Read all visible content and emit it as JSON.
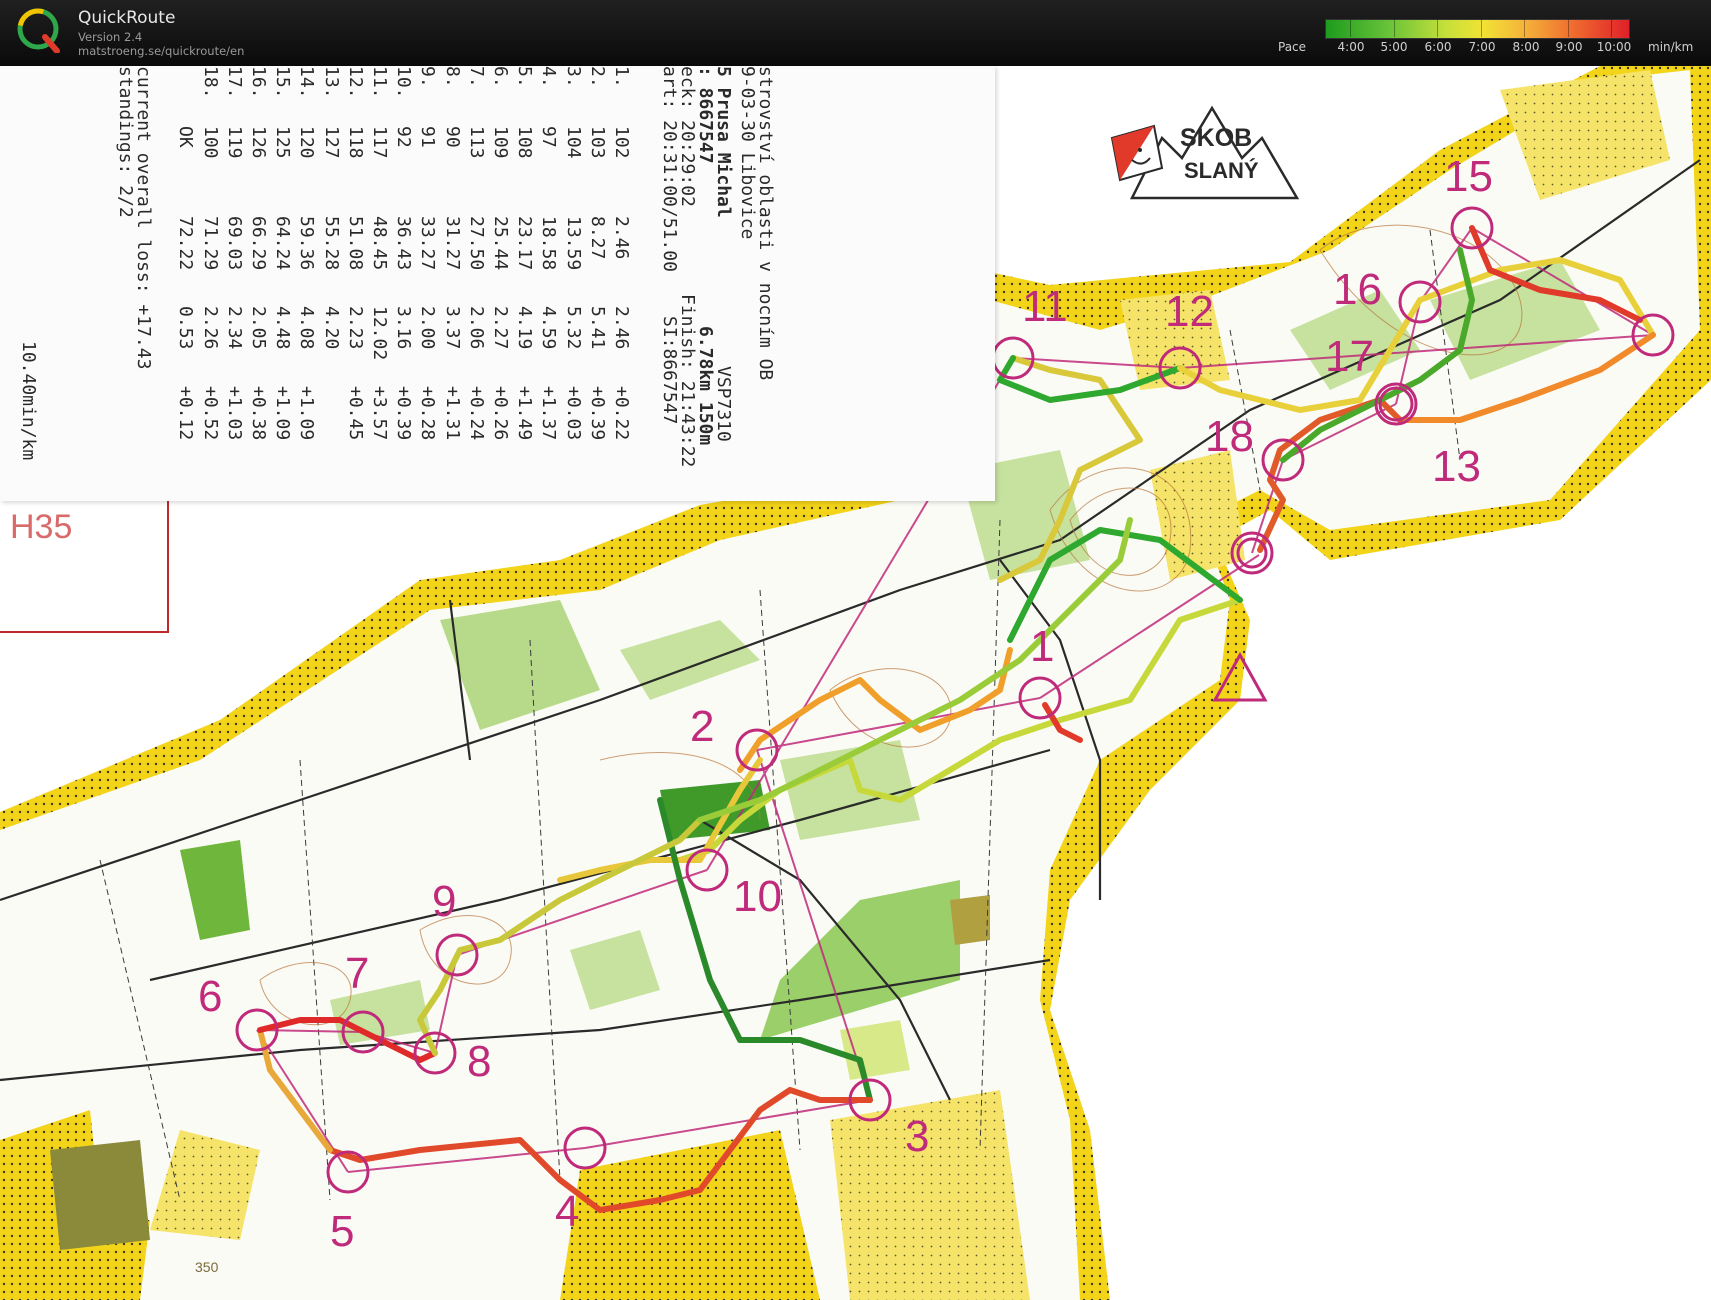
{
  "app": {
    "name": "QuickRoute",
    "version": "Version 2.4",
    "url": "matstroeng.se/quickroute/en"
  },
  "pace_legend": {
    "label": "Pace",
    "ticks": [
      "4:00",
      "5:00",
      "6:00",
      "7:00",
      "8:00",
      "9:00",
      "10:00"
    ],
    "unit": "min/km"
  },
  "colors": {
    "topbar": "#111111",
    "route_fast": "#1e9b1e",
    "route_slow": "#e0202a",
    "control": "#c02a7a",
    "map_yellow": "#f2d21b",
    "map_green": "#8cc63f"
  },
  "map_brand": {
    "line1": "SKOB",
    "line2": "SLANÝ"
  },
  "category_label": "H35",
  "receipt": {
    "header_lines": [
      "strovství oblasti v nocním OB",
      "9-03-30 Libovice",
      "5 Prusa Michal",
      ": 8667547",
      "eck: 20:29:02",
      "art: 20:31:00/51.00"
    ],
    "right_block": {
      "code": "VSP7310",
      "course": "6.78km 150m",
      "finish": "Finish: 21:43:22",
      "si": "SI:8667547"
    },
    "splits": [
      {
        "n": "1.",
        "code": "102",
        "total": "2.46",
        "split": "2.46",
        "loss": "+0.22"
      },
      {
        "n": "2.",
        "code": "103",
        "total": "8.27",
        "split": "5.41",
        "loss": "+0.39"
      },
      {
        "n": "3.",
        "code": "104",
        "total": "13.59",
        "split": "5.32",
        "loss": "+0.03"
      },
      {
        "n": "4.",
        "code": "97",
        "total": "18.58",
        "split": "4.59",
        "loss": "+1.37"
      },
      {
        "n": "5.",
        "code": "108",
        "total": "23.17",
        "split": "4.19",
        "loss": "+1.49"
      },
      {
        "n": "6.",
        "code": "109",
        "total": "25.44",
        "split": "2.27",
        "loss": "+0.26"
      },
      {
        "n": "7.",
        "code": "113",
        "total": "27.50",
        "split": "2.06",
        "loss": "+0.24"
      },
      {
        "n": "8.",
        "code": "90",
        "total": "31.27",
        "split": "3.37",
        "loss": "+1.31"
      },
      {
        "n": "9.",
        "code": "91",
        "total": "33.27",
        "split": "2.00",
        "loss": "+0.28"
      },
      {
        "n": "10.",
        "code": "92",
        "total": "36.43",
        "split": "3.16",
        "loss": "+0.39"
      },
      {
        "n": "11.",
        "code": "117",
        "total": "48.45",
        "split": "12.02",
        "loss": "+3.57"
      },
      {
        "n": "12.",
        "code": "118",
        "total": "51.08",
        "split": "2.23",
        "loss": "+0.45"
      },
      {
        "n": "13.",
        "code": "127",
        "total": "55.28",
        "split": "4.20",
        "loss": ""
      },
      {
        "n": "14.",
        "code": "120",
        "total": "59.36",
        "split": "4.08",
        "loss": "+1.09"
      },
      {
        "n": "15.",
        "code": "125",
        "total": "64.24",
        "split": "4.48",
        "loss": "+1.09"
      },
      {
        "n": "16.",
        "code": "126",
        "total": "66.29",
        "split": "2.05",
        "loss": "+0.38"
      },
      {
        "n": "17.",
        "code": "119",
        "total": "69.03",
        "split": "2.34",
        "loss": "+1.03"
      },
      {
        "n": "18.",
        "code": "100",
        "total": "71.29",
        "split": "2.26",
        "loss": "+0.52"
      }
    ],
    "finish_row": {
      "n": "",
      "code": "OK",
      "total": "72.22",
      "split": "0.53",
      "loss": "+0.12"
    },
    "footer_lines": [
      "current overall loss: +17.43",
      "standings: 2/2"
    ],
    "pace_note": "10.40min/km"
  },
  "controls": [
    {
      "label": "1"
    },
    {
      "label": "2"
    },
    {
      "label": "3"
    },
    {
      "label": "4"
    },
    {
      "label": "5"
    },
    {
      "label": "6"
    },
    {
      "label": "7"
    },
    {
      "label": "8"
    },
    {
      "label": "9"
    },
    {
      "label": "10"
    },
    {
      "label": "11"
    },
    {
      "label": "12"
    },
    {
      "label": "13"
    },
    {
      "label": "15"
    },
    {
      "label": "16"
    },
    {
      "label": "17"
    },
    {
      "label": "18"
    }
  ],
  "contour_label": "350"
}
